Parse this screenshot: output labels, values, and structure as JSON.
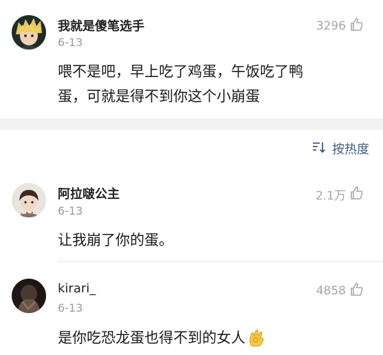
{
  "comments_top": {
    "username": "我就是傻笔选手",
    "date": "6-13",
    "likes": "3296",
    "text_line1": "喂不是吧，早上吃了鸡蛋，午饭吃了鸭",
    "text_line2": "蛋，可就是得不到你这个小崩蛋"
  },
  "sort": {
    "label": "按热度"
  },
  "comments": [
    {
      "username": "阿拉啵公主",
      "date": "6-13",
      "likes": "2.1万",
      "text": "让我崩了你的蛋。"
    },
    {
      "username": "kirari_",
      "date": "6-13",
      "likes": "4858",
      "text": "是你吃恐龙蛋也得不到的女人"
    }
  ],
  "icons": {
    "like": "thumbs-up-icon",
    "sort": "sort-icon",
    "ok_emoji": "ok-hand-emoji"
  },
  "colors": {
    "sort_accent": "#3e5d86",
    "separator_band": "#f2f2f2",
    "meta_gray": "#9a9a9a"
  }
}
